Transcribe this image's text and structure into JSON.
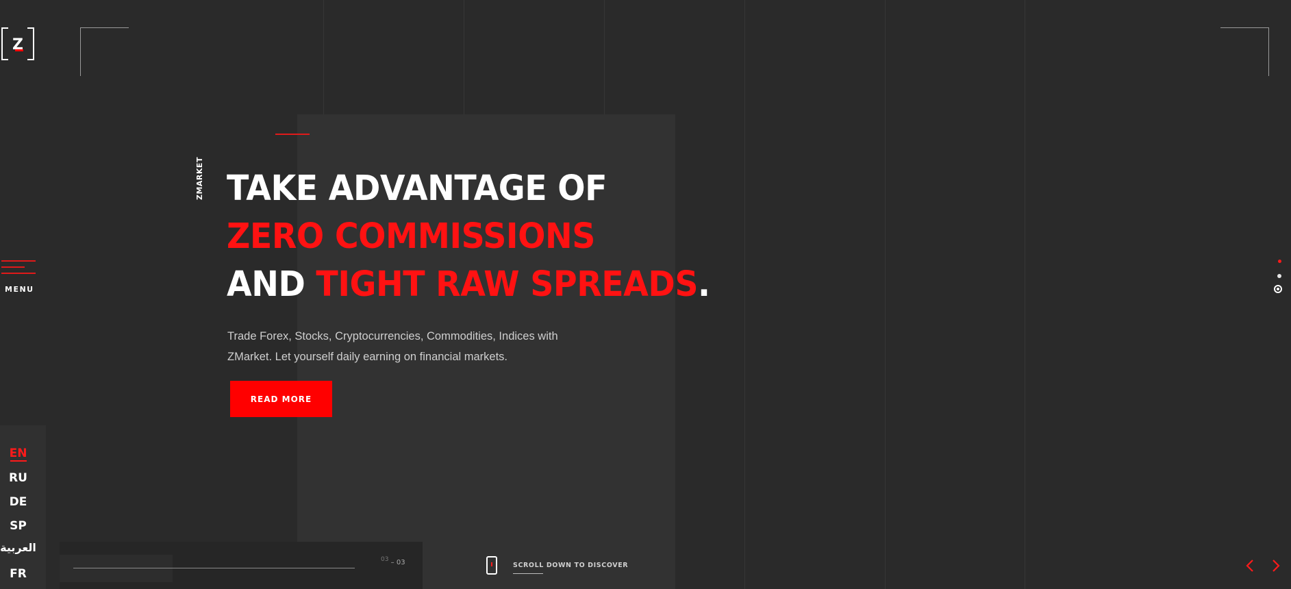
{
  "brand": {
    "logo_letter": "Z",
    "vertical_label": "ZMARKET"
  },
  "menu": {
    "label": "MENU"
  },
  "hero": {
    "headline_line1": "TAKE ADVANTAGE OF",
    "headline_line2": "ZERO COMMISSIONS",
    "headline_line3_white": "AND ",
    "headline_line3_red": "TIGHT RAW SPREADS",
    "headline_line3_end": ".",
    "subtitle": "Trade Forex, Stocks, Cryptocurrencies, Commodities, Indices with ZMarket. Let yourself daily earning on financial markets.",
    "cta_label": "READ MORE"
  },
  "languages": {
    "items": [
      {
        "label": "EN",
        "active": true
      },
      {
        "label": "RU",
        "active": false
      },
      {
        "label": "DE",
        "active": false
      },
      {
        "label": "SP",
        "active": false
      },
      {
        "label": "العربية",
        "active": false
      },
      {
        "label": "FR",
        "active": false
      }
    ]
  },
  "slider": {
    "current": "03",
    "separator": "–",
    "total": "03",
    "progress": 1.0
  },
  "scroll": {
    "label": "SCROLL DOWN TO DISCOVER"
  },
  "pagination": {
    "count": 3,
    "active_index": 2
  },
  "colors": {
    "background": "#2a2a2a",
    "panel": "#323232",
    "accent": "#ff0000",
    "text": "#ffffff"
  },
  "icons": {
    "logo": "z-logo-icon",
    "menu": "hamburger-icon",
    "phone": "phone-scroll-icon",
    "prev": "chevron-left-icon",
    "next": "chevron-right-icon"
  }
}
